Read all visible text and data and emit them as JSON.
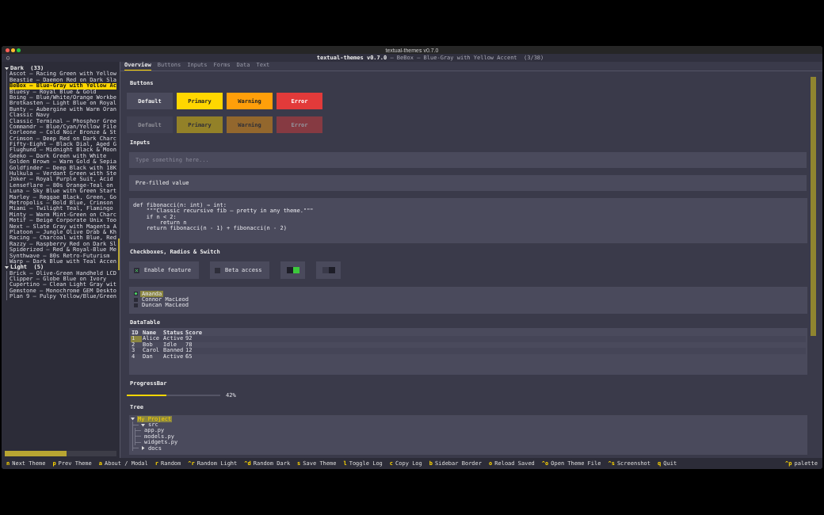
{
  "window": {
    "title": "textual-themes v0.7.0"
  },
  "header": {
    "icon": "○",
    "title": "**textual-themes v0.7.0** — BeBox — Blue-Gray with Yellow Accent  (3/38)"
  },
  "sidebar": {
    "groups": [
      {
        "label": "Dark",
        "count": "(33)",
        "expanded": true,
        "items": [
          {
            "label": "Ascot — Racing Green with Yellow",
            "selected": false
          },
          {
            "label": "Beastie — Daemon Red on Dark Sla",
            "selected": false
          },
          {
            "label": "BeBox — Blue-Gray with Yellow Ac",
            "selected": true
          },
          {
            "label": "Bluesy — Royal Blue & Gold",
            "selected": false
          },
          {
            "label": "Boing — Blue/White/Orange Workbe",
            "selected": false
          },
          {
            "label": "Brotkasten — Light Blue on Royal",
            "selected": false
          },
          {
            "label": "Bunty — Aubergine with Warm Oran",
            "selected": false
          },
          {
            "label": "Classic Navy",
            "selected": false
          },
          {
            "label": "Classic Terminal — Phosphor Gree",
            "selected": false
          },
          {
            "label": "Commandr — Blue/Cyan/Yellow File",
            "selected": false
          },
          {
            "label": "Corleone — Cold Noir Bronze & St",
            "selected": false
          },
          {
            "label": "Crimson — Deep Red on Dark Charc",
            "selected": false
          },
          {
            "label": "Fifty-Eight — Black Dial, Aged G",
            "selected": false
          },
          {
            "label": "Flughund — Midnight Black & Moon",
            "selected": false
          },
          {
            "label": "Geeko — Dark Green with White",
            "selected": false
          },
          {
            "label": "Golden Brown — Warm Gold & Sepia",
            "selected": false
          },
          {
            "label": "Goldfinder — Deep Black with 18K",
            "selected": false
          },
          {
            "label": "Hulkula — Verdant Green with Ste",
            "selected": false
          },
          {
            "label": "Joker — Royal Purple Suit, Acid",
            "selected": false
          },
          {
            "label": "Lenseflare — 80s Orange-Teal on",
            "selected": false
          },
          {
            "label": "Luna — Sky Blue with Green Start",
            "selected": false
          },
          {
            "label": "Marley — Reggae Black, Green, Go",
            "selected": false
          },
          {
            "label": "Metropolis — Bold Blue, Crimson",
            "selected": false
          },
          {
            "label": "Miami — Twilight Teal, Flamingo",
            "selected": false
          },
          {
            "label": "Minty — Warm Mint-Green on Charc",
            "selected": false
          },
          {
            "label": "Motif — Beige Corporate Unix Too",
            "selected": false
          },
          {
            "label": "Next — Slate Gray with Magenta A",
            "selected": false
          },
          {
            "label": "Platoon — Jungle Olive Drab & Kh",
            "selected": false
          },
          {
            "label": "Racing — Charcoal with Blue, Red",
            "selected": false
          },
          {
            "label": "Razzy — Raspberry Red on Dark Sl",
            "selected": false
          },
          {
            "label": "Spiderized — Red & Royal-Blue Me",
            "selected": false
          },
          {
            "label": "Synthwave — 80s Retro-Futurism",
            "selected": false
          },
          {
            "label": "Warp — Dark Blue with Teal Accen",
            "selected": false
          }
        ]
      },
      {
        "label": "Light",
        "count": "(5)",
        "expanded": true,
        "items": [
          {
            "label": "Brick — Olive-Green Handheld LCD",
            "selected": false
          },
          {
            "label": "Clipper — Globe Blue on Ivory",
            "selected": false
          },
          {
            "label": "Cupertino — Clean Light Gray wit",
            "selected": false
          },
          {
            "label": "Gemstone — Monochrome GEM Deskto",
            "selected": false
          },
          {
            "label": "Plan 9 — Pulpy Yellow/Blue/Green",
            "selected": false
          }
        ]
      }
    ]
  },
  "tabs": [
    {
      "label": "Overview",
      "selected": true
    },
    {
      "label": "Buttons",
      "selected": false
    },
    {
      "label": "Inputs",
      "selected": false
    },
    {
      "label": "Forms",
      "selected": false
    },
    {
      "label": "Data",
      "selected": false
    },
    {
      "label": "Text",
      "selected": false
    }
  ],
  "buttons_section": {
    "heading": "Buttons",
    "rows": [
      [
        {
          "label": "Default",
          "kind": "default",
          "disabled": false
        },
        {
          "label": "Primary",
          "kind": "primary",
          "disabled": false
        },
        {
          "label": "Warning",
          "kind": "warning",
          "disabled": false
        },
        {
          "label": "Error",
          "kind": "error",
          "disabled": false
        }
      ],
      [
        {
          "label": "Default",
          "kind": "default",
          "disabled": true
        },
        {
          "label": "Primary",
          "kind": "primary",
          "disabled": true
        },
        {
          "label": "Warning",
          "kind": "warning",
          "disabled": true
        },
        {
          "label": "Error",
          "kind": "error",
          "disabled": true
        }
      ]
    ]
  },
  "inputs_section": {
    "heading": "Inputs",
    "empty_input": {
      "placeholder": "Type something here..."
    },
    "filled_input": {
      "value": "Pre-filled value"
    },
    "code": [
      "def fibonacci(n: int) → int:",
      "    \"\"\"Classic recursive fib — pretty in any theme.\"\"\"",
      "    if n < 2:",
      "        return n",
      "    return fibonacci(n - 1) + fibonacci(n - 2)"
    ]
  },
  "toggles_section": {
    "heading": "Checkboxes, Radios & Switch",
    "checkboxes": [
      {
        "label": "Enable feature",
        "checked": true
      },
      {
        "label": "Beta access",
        "checked": false
      }
    ],
    "switches": [
      {
        "on": true
      },
      {
        "on": false
      }
    ],
    "radios": [
      {
        "label": "Amanda",
        "selected": true
      },
      {
        "label": "Connor MacLeod",
        "selected": false
      },
      {
        "label": "Duncan MacLeod",
        "selected": false
      }
    ]
  },
  "table_section": {
    "heading": "DataTable",
    "columns": [
      "ID",
      "Name",
      "Status",
      "Score"
    ],
    "rows": [
      {
        "cells": [
          "1",
          "Alice",
          "Active",
          "92"
        ],
        "selected": true
      },
      {
        "cells": [
          "2",
          "Bob",
          "Idle",
          "78"
        ],
        "selected": false
      },
      {
        "cells": [
          "3",
          "Carol",
          "Banned",
          "12"
        ],
        "selected": false
      },
      {
        "cells": [
          "4",
          "Dan",
          "Active",
          "65"
        ],
        "selected": false
      }
    ]
  },
  "progress_section": {
    "heading": "ProgressBar",
    "level": 0.42,
    "reading": "42%"
  },
  "tree_section": {
    "heading": "Tree",
    "nodes": [
      {
        "label": "My Project",
        "expanded": true,
        "selected": true,
        "children": [
          {
            "label": "src",
            "expanded": true,
            "selected": false,
            "children": [
              {
                "label": "app.py",
                "selected": false
              },
              {
                "label": "models.py",
                "selected": false
              },
              {
                "label": "widgets.py",
                "selected": false
              }
            ]
          },
          {
            "label": "docs",
            "expanded": false,
            "selected": false
          }
        ]
      }
    ]
  },
  "footer": {
    "bindings": [
      {
        "key": "n",
        "label": "Next Theme"
      },
      {
        "key": "p",
        "label": "Prev Theme"
      },
      {
        "key": "a",
        "label": "About / Modal"
      },
      {
        "key": "r",
        "label": "Random"
      },
      {
        "key": "^r",
        "label": "Random Light"
      },
      {
        "key": "^d",
        "label": "Random Dark"
      },
      {
        "key": "s",
        "label": "Save Theme"
      },
      {
        "key": "l",
        "label": "Toggle Log"
      },
      {
        "key": "c",
        "label": "Copy Log"
      },
      {
        "key": "b",
        "label": "Sidebar Border"
      },
      {
        "key": "o",
        "label": "Reload Saved"
      },
      {
        "key": "^o",
        "label": "Open Theme File"
      },
      {
        "key": "^s",
        "label": "Screenshot"
      },
      {
        "key": "q",
        "label": "Quit"
      }
    ],
    "palette": {
      "key": "^p",
      "label": "palette"
    }
  }
}
